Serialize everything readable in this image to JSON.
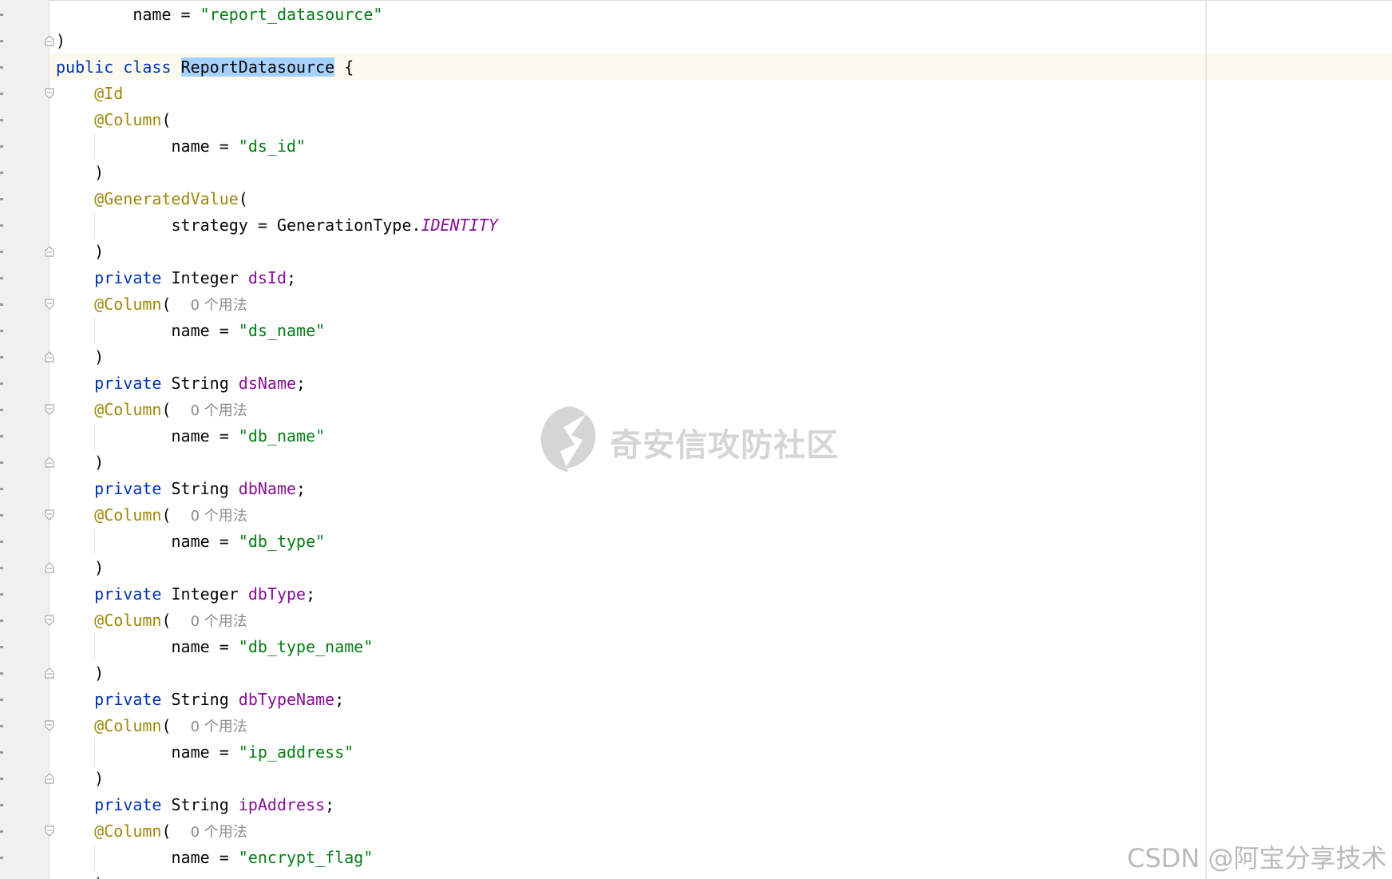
{
  "editor": {
    "lines": [
      {
        "parts": [
          [
            "",
            "        name = "
          ],
          [
            "str",
            "\"report_datasource\""
          ]
        ]
      },
      {
        "parts": [
          [
            "",
            ")"
          ]
        ]
      },
      {
        "parts": [
          [
            "kw",
            "public"
          ],
          [
            "",
            " "
          ],
          [
            "kw",
            "class"
          ],
          [
            "",
            " "
          ],
          [
            "hl",
            "ReportDatasource"
          ],
          [
            "",
            " {"
          ]
        ]
      },
      {
        "parts": [
          [
            "",
            "    "
          ],
          [
            "ann",
            "@Id"
          ]
        ]
      },
      {
        "parts": [
          [
            "",
            "    "
          ],
          [
            "ann",
            "@Column"
          ],
          [
            "",
            "("
          ]
        ]
      },
      {
        "parts": [
          [
            "",
            "            name = "
          ],
          [
            "str",
            "\"ds_id\""
          ]
        ]
      },
      {
        "parts": [
          [
            "",
            "    )"
          ]
        ]
      },
      {
        "parts": [
          [
            "",
            "    "
          ],
          [
            "ann",
            "@GeneratedValue"
          ],
          [
            "",
            "("
          ]
        ]
      },
      {
        "parts": [
          [
            "",
            "            strategy = GenerationType."
          ],
          [
            "const",
            "IDENTITY"
          ]
        ]
      },
      {
        "parts": [
          [
            "",
            "    )"
          ]
        ]
      },
      {
        "parts": [
          [
            "",
            "    "
          ],
          [
            "kw",
            "private"
          ],
          [
            "",
            " Integer "
          ],
          [
            "fld",
            "dsId"
          ],
          [
            "",
            ";"
          ]
        ]
      },
      {
        "parts": [
          [
            "",
            "    "
          ],
          [
            "ann",
            "@Column"
          ],
          [
            "",
            "(  "
          ],
          [
            "hint",
            "0 个用法"
          ]
        ]
      },
      {
        "parts": [
          [
            "",
            "            name = "
          ],
          [
            "str",
            "\"ds_name\""
          ]
        ]
      },
      {
        "parts": [
          [
            "",
            "    )"
          ]
        ]
      },
      {
        "parts": [
          [
            "",
            "    "
          ],
          [
            "kw",
            "private"
          ],
          [
            "",
            " String "
          ],
          [
            "fld",
            "dsName"
          ],
          [
            "",
            ";"
          ]
        ]
      },
      {
        "parts": [
          [
            "",
            "    "
          ],
          [
            "ann",
            "@Column"
          ],
          [
            "",
            "(  "
          ],
          [
            "hint",
            "0 个用法"
          ]
        ]
      },
      {
        "parts": [
          [
            "",
            "            name = "
          ],
          [
            "str",
            "\"db_name\""
          ]
        ]
      },
      {
        "parts": [
          [
            "",
            "    )"
          ]
        ]
      },
      {
        "parts": [
          [
            "",
            "    "
          ],
          [
            "kw",
            "private"
          ],
          [
            "",
            " String "
          ],
          [
            "fld",
            "dbName"
          ],
          [
            "",
            ";"
          ]
        ]
      },
      {
        "parts": [
          [
            "",
            "    "
          ],
          [
            "ann",
            "@Column"
          ],
          [
            "",
            "(  "
          ],
          [
            "hint",
            "0 个用法"
          ]
        ]
      },
      {
        "parts": [
          [
            "",
            "            name = "
          ],
          [
            "str",
            "\"db_type\""
          ]
        ]
      },
      {
        "parts": [
          [
            "",
            "    )"
          ]
        ]
      },
      {
        "parts": [
          [
            "",
            "    "
          ],
          [
            "kw",
            "private"
          ],
          [
            "",
            " Integer "
          ],
          [
            "fld",
            "dbType"
          ],
          [
            "",
            ";"
          ]
        ]
      },
      {
        "parts": [
          [
            "",
            "    "
          ],
          [
            "ann",
            "@Column"
          ],
          [
            "",
            "(  "
          ],
          [
            "hint",
            "0 个用法"
          ]
        ]
      },
      {
        "parts": [
          [
            "",
            "            name = "
          ],
          [
            "str",
            "\"db_type_name\""
          ]
        ]
      },
      {
        "parts": [
          [
            "",
            "    )"
          ]
        ]
      },
      {
        "parts": [
          [
            "",
            "    "
          ],
          [
            "kw",
            "private"
          ],
          [
            "",
            " String "
          ],
          [
            "fld",
            "dbTypeName"
          ],
          [
            "",
            ";"
          ]
        ]
      },
      {
        "parts": [
          [
            "",
            "    "
          ],
          [
            "ann",
            "@Column"
          ],
          [
            "",
            "(  "
          ],
          [
            "hint",
            "0 个用法"
          ]
        ]
      },
      {
        "parts": [
          [
            "",
            "            name = "
          ],
          [
            "str",
            "\"ip_address\""
          ]
        ]
      },
      {
        "parts": [
          [
            "",
            "    )"
          ]
        ]
      },
      {
        "parts": [
          [
            "",
            "    "
          ],
          [
            "kw",
            "private"
          ],
          [
            "",
            " String "
          ],
          [
            "fld",
            "ipAddress"
          ],
          [
            "",
            ";"
          ]
        ]
      },
      {
        "parts": [
          [
            "",
            "    "
          ],
          [
            "ann",
            "@Column"
          ],
          [
            "",
            "(  "
          ],
          [
            "hint",
            "0 个用法"
          ]
        ]
      },
      {
        "parts": [
          [
            "",
            "            name = "
          ],
          [
            "str",
            "\"encrypt_flag\""
          ]
        ]
      },
      {
        "parts": [
          [
            "",
            "    )"
          ]
        ]
      }
    ],
    "fold_markers": [
      {
        "line": 1,
        "kind": "end"
      },
      {
        "line": 3,
        "kind": "start"
      },
      {
        "line": 9,
        "kind": "end"
      },
      {
        "line": 11,
        "kind": "start"
      },
      {
        "line": 13,
        "kind": "end"
      },
      {
        "line": 15,
        "kind": "start"
      },
      {
        "line": 17,
        "kind": "end"
      },
      {
        "line": 19,
        "kind": "start"
      },
      {
        "line": 21,
        "kind": "end"
      },
      {
        "line": 23,
        "kind": "start"
      },
      {
        "line": 25,
        "kind": "end"
      },
      {
        "line": 27,
        "kind": "start"
      },
      {
        "line": 29,
        "kind": "end"
      },
      {
        "line": 31,
        "kind": "start"
      }
    ],
    "highlighted_line": 2,
    "colors": {
      "keyword": "#0033b3",
      "annotation": "#9e880d",
      "string": "#067d17",
      "field": "#871094",
      "selection": "#a6d2ff",
      "caret_row": "#fcfaed"
    }
  },
  "watermarks": {
    "center": "奇安信攻防社区",
    "corner": "CSDN @阿宝分享技术"
  }
}
